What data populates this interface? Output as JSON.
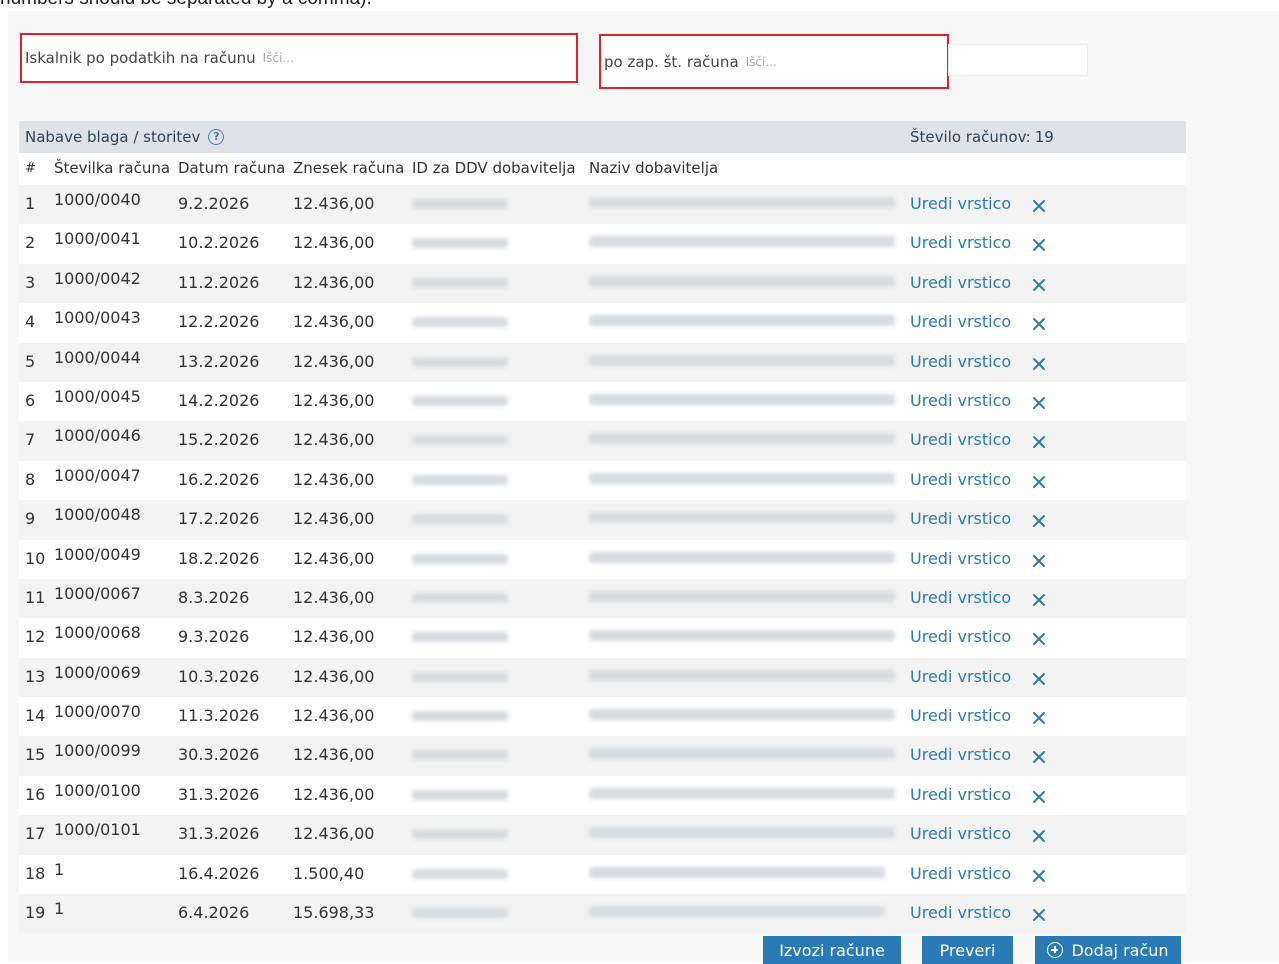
{
  "top_note": "numbers should be separated by a comma).",
  "search": {
    "by_invoice_data_label": "Iskalnik po podatkih na računu",
    "by_invoice_data_placeholder": "Išči...",
    "by_seq_number_label": "po zap. št. računa",
    "by_seq_number_placeholder": "Išči..."
  },
  "table": {
    "title": "Nabave blaga / storitev",
    "count_label": "Število računov:",
    "count_value": "19",
    "columns": {
      "idx": "#",
      "number": "Številka računa",
      "date": "Datum računa",
      "amount": "Znesek računa",
      "vat_id": "ID za DDV dobavitelja",
      "supplier": "Naziv dobavitelja"
    },
    "edit_label": "Uredi vrstico",
    "rows": [
      {
        "idx": "1",
        "number": "1000/0040",
        "date": "9.2.2026",
        "amount": "12.436,00"
      },
      {
        "idx": "2",
        "number": "1000/0041",
        "date": "10.2.2026",
        "amount": "12.436,00"
      },
      {
        "idx": "3",
        "number": "1000/0042",
        "date": "11.2.2026",
        "amount": "12.436,00"
      },
      {
        "idx": "4",
        "number": "1000/0043",
        "date": "12.2.2026",
        "amount": "12.436,00"
      },
      {
        "idx": "5",
        "number": "1000/0044",
        "date": "13.2.2026",
        "amount": "12.436,00"
      },
      {
        "idx": "6",
        "number": "1000/0045",
        "date": "14.2.2026",
        "amount": "12.436,00"
      },
      {
        "idx": "7",
        "number": "1000/0046",
        "date": "15.2.2026",
        "amount": "12.436,00"
      },
      {
        "idx": "8",
        "number": "1000/0047",
        "date": "16.2.2026",
        "amount": "12.436,00"
      },
      {
        "idx": "9",
        "number": "1000/0048",
        "date": "17.2.2026",
        "amount": "12.436,00"
      },
      {
        "idx": "10",
        "number": "1000/0049",
        "date": "18.2.2026",
        "amount": "12.436,00"
      },
      {
        "idx": "11",
        "number": "1000/0067",
        "date": "8.3.2026",
        "amount": "12.436,00"
      },
      {
        "idx": "12",
        "number": "1000/0068",
        "date": "9.3.2026",
        "amount": "12.436,00"
      },
      {
        "idx": "13",
        "number": "1000/0069",
        "date": "10.3.2026",
        "amount": "12.436,00"
      },
      {
        "idx": "14",
        "number": "1000/0070",
        "date": "11.3.2026",
        "amount": "12.436,00"
      },
      {
        "idx": "15",
        "number": "1000/0099",
        "date": "30.3.2026",
        "amount": "12.436,00"
      },
      {
        "idx": "16",
        "number": "1000/0100",
        "date": "31.3.2026",
        "amount": "12.436,00"
      },
      {
        "idx": "17",
        "number": "1000/0101",
        "date": "31.3.2026",
        "amount": "12.436,00"
      },
      {
        "idx": "18",
        "number": "1",
        "date": "16.4.2026",
        "amount": "1.500,40"
      },
      {
        "idx": "19",
        "number": "1",
        "date": "6.4.2026",
        "amount": "15.698,33"
      }
    ]
  },
  "buttons": {
    "export": "Izvozi račune",
    "check": "Preveri",
    "add": "Dodaj račun"
  },
  "colors": {
    "accent": "#2a7ab8",
    "highlight_border": "#d9242c",
    "title_bar": "#dde3e7"
  },
  "icons": {
    "help": "question-circle-icon",
    "delete": "close-x-icon",
    "add": "plus-circle-icon"
  }
}
